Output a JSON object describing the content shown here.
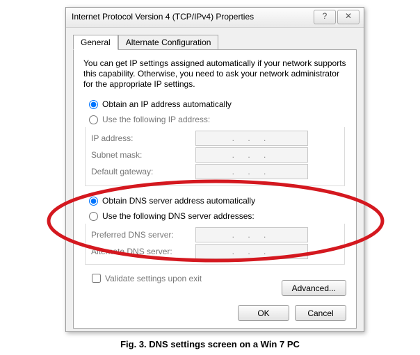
{
  "window": {
    "title": "Internet Protocol Version 4 (TCP/IPv4) Properties",
    "help_glyph": "?",
    "close_glyph": "✕"
  },
  "tabs": {
    "general": "General",
    "alternate": "Alternate Configuration"
  },
  "description": "You can get IP settings assigned automatically if your network supports this capability. Otherwise, you need to ask your network administrator for the appropriate IP settings.",
  "ip": {
    "auto": "Obtain an IP address automatically",
    "manual": "Use the following IP address:",
    "address_label": "IP address:",
    "subnet_label": "Subnet mask:",
    "gateway_label": "Default gateway:",
    "placeholder": ".   .   ."
  },
  "dns": {
    "auto": "Obtain DNS server address automatically",
    "manual": "Use the following DNS server addresses:",
    "preferred_label": "Preferred DNS server:",
    "alternate_label": "Alternate DNS server:",
    "placeholder": ".   .   ."
  },
  "validate_label": "Validate settings upon exit",
  "buttons": {
    "advanced": "Advanced...",
    "ok": "OK",
    "cancel": "Cancel"
  },
  "caption": "Fig. 3. DNS settings screen on a Win 7 PC",
  "colors": {
    "annotation": "#d4181f"
  }
}
